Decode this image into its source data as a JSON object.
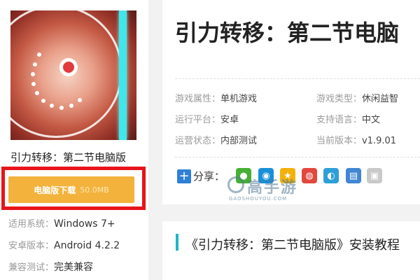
{
  "app": {
    "name": "引力转移：第二节电脑版"
  },
  "download": {
    "label": "电脑版下载",
    "size": "50.0MB"
  },
  "specs": [
    {
      "label": "适用系统：",
      "value": "Windows 7+"
    },
    {
      "label": "安卓版本：",
      "value": "Android 4.2.2"
    },
    {
      "label": "兼容测试：",
      "value": "完美兼容"
    }
  ],
  "info": {
    "title": "引力转移：第二节电脑",
    "fields": [
      {
        "key": "游戏属性：",
        "value": "单机游戏"
      },
      {
        "key": "游戏类型：",
        "value": "休闲益智"
      },
      {
        "key": "运行平台：",
        "value": "安卓"
      },
      {
        "key": "支持语言：",
        "value": "中文"
      },
      {
        "key": "运营状态：",
        "value": "内部测试"
      },
      {
        "key": "当前版本：",
        "value": "v1.9.01"
      }
    ]
  },
  "share": {
    "label": "分享：",
    "plus": "+",
    "icons": [
      {
        "name": "wechat-icon",
        "color": "#45b035"
      },
      {
        "name": "qq-icon",
        "color": "#1a8fd8"
      },
      {
        "name": "qzone-icon",
        "color": "#f2b10b"
      },
      {
        "name": "weibo-icon",
        "color": "#e2483d"
      },
      {
        "name": "tencent-weibo-icon",
        "color": "#2d9fd9"
      },
      {
        "name": "print-icon",
        "color": "#3f86d4"
      },
      {
        "name": "copy-icon",
        "color": "#c9c9c9"
      }
    ]
  },
  "watermark": {
    "text": "高手游",
    "sub": "GAOSHOUYOU.COM"
  },
  "tutorial": {
    "title": "《引力转移：第二节电脑版》安装教程"
  },
  "colors": {
    "download_button": "#f3b23c",
    "highlight_frame": "#e8141b",
    "accent_bar": "#1fb6c8",
    "icon_stripe": "#3fe7ea"
  }
}
